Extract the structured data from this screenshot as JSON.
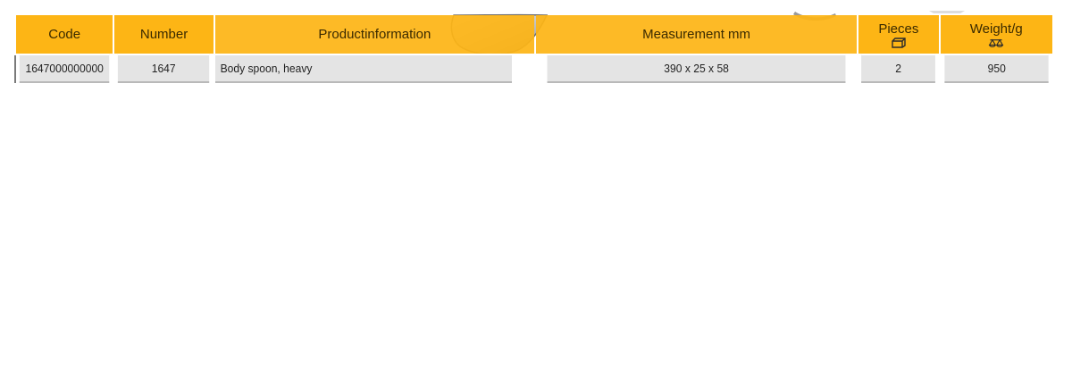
{
  "header": {
    "columns": [
      {
        "label": "Code",
        "icon": ""
      },
      {
        "label": "Number",
        "icon": ""
      },
      {
        "label": "Productinformation",
        "icon": ""
      },
      {
        "label": "Measurement mm",
        "icon": ""
      },
      {
        "label": "Pieces",
        "icon": "box-icon"
      },
      {
        "label": "Weight/g",
        "icon": "scale-icon"
      }
    ]
  },
  "rows": [
    {
      "code": "1647000000000",
      "number": "1647",
      "productinformation": "Body spoon, heavy",
      "measurement": "390 x 25 x 58",
      "pieces": "2",
      "weight": "950"
    }
  ],
  "colors": {
    "header_bg": "#fdb515",
    "row_bg": "#e4e4e4"
  }
}
